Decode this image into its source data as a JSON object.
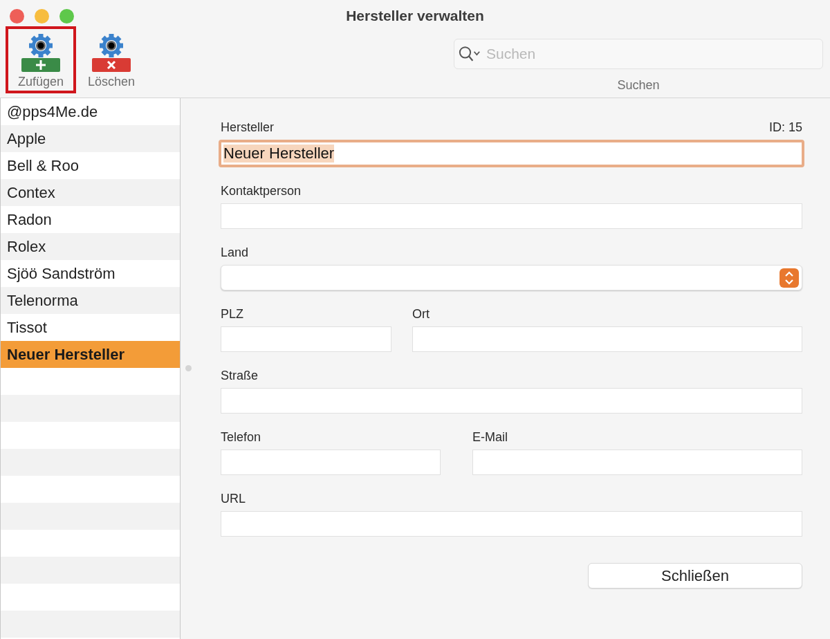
{
  "window": {
    "title": "Hersteller verwalten"
  },
  "toolbar": {
    "buttons": [
      {
        "label": "Zufügen",
        "kind": "add",
        "highlighted": true
      },
      {
        "label": "Löschen",
        "kind": "delete",
        "highlighted": false
      }
    ]
  },
  "search": {
    "placeholder": "Suchen",
    "label": "Suchen"
  },
  "list": {
    "items": [
      {
        "label": "@pps4Me.de",
        "selected": false
      },
      {
        "label": "Apple",
        "selected": false
      },
      {
        "label": "Bell & Roo",
        "selected": false
      },
      {
        "label": "Contex",
        "selected": false
      },
      {
        "label": "Radon",
        "selected": false
      },
      {
        "label": "Rolex",
        "selected": false
      },
      {
        "label": "Sjöö Sandström",
        "selected": false
      },
      {
        "label": "Telenorma",
        "selected": false
      },
      {
        "label": "Tissot",
        "selected": false
      },
      {
        "label": "Neuer Hersteller",
        "selected": true
      }
    ]
  },
  "form": {
    "rows": [
      [
        {
          "label": "Hersteller",
          "kind": "text",
          "value": "Neuer Hersteller",
          "focused": true,
          "aside": "ID: 15"
        }
      ],
      [
        {
          "label": "Kontaktperson",
          "kind": "text",
          "focused": false
        }
      ],
      [
        {
          "label": "Land",
          "kind": "select",
          "focused": false
        }
      ],
      [
        {
          "label": "PLZ",
          "kind": "text",
          "focused": false
        },
        {
          "label": "Ort",
          "kind": "text",
          "focused": false
        }
      ],
      [
        {
          "label": "Straße",
          "kind": "text",
          "focused": false
        }
      ],
      [
        {
          "label": "Telefon",
          "kind": "text",
          "focused": false
        },
        {
          "label": "E-Mail",
          "kind": "text",
          "focused": false
        }
      ],
      [
        {
          "label": "URL",
          "kind": "text",
          "focused": false
        }
      ]
    ],
    "close_button": "Schließen"
  }
}
